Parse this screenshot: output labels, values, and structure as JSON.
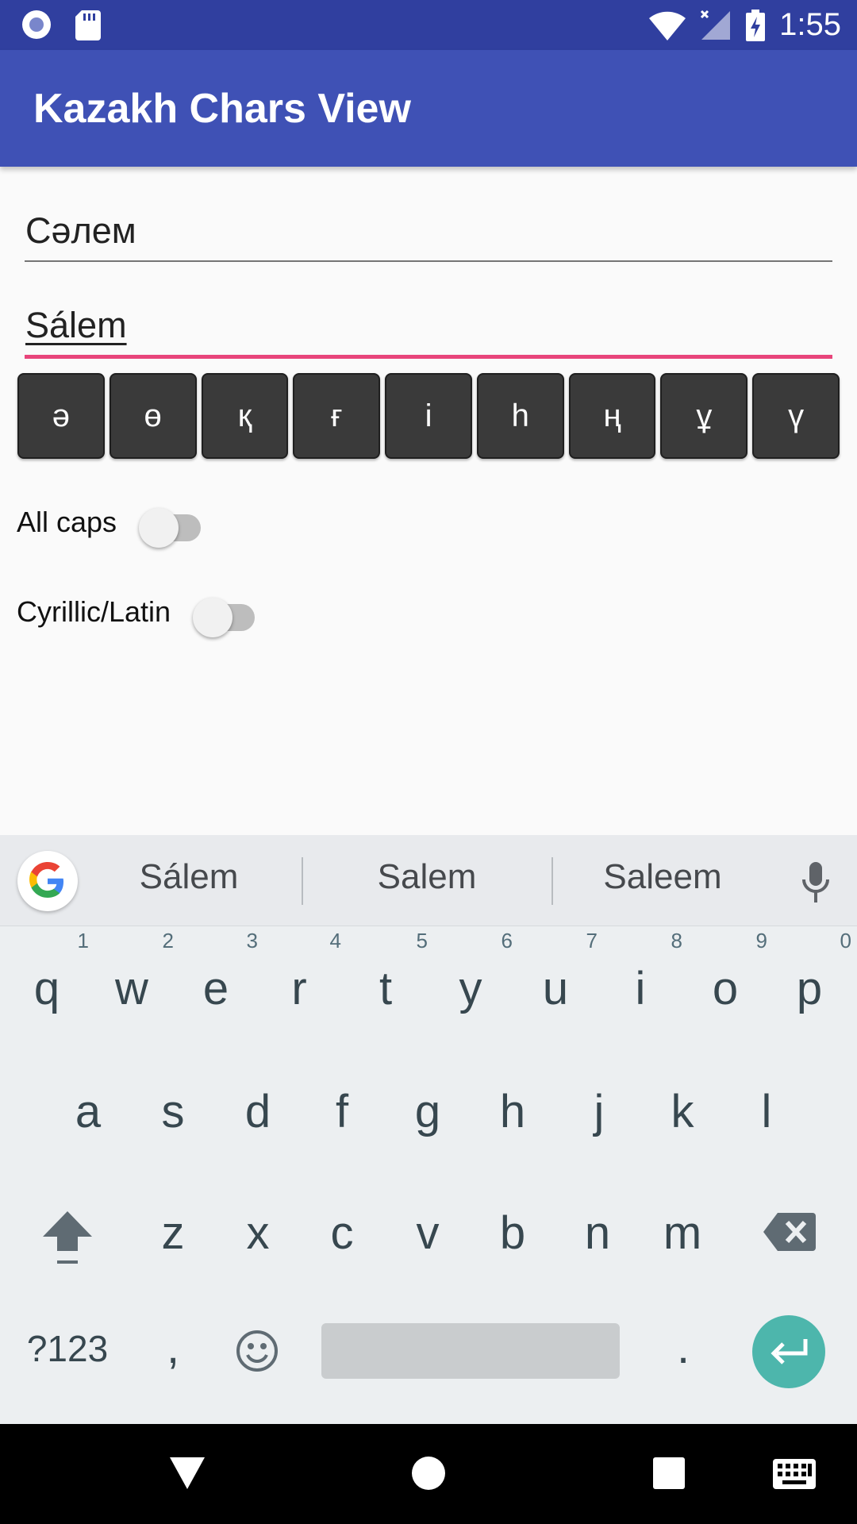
{
  "status_bar": {
    "time": "1:55"
  },
  "app_bar": {
    "title": "Kazakh Chars View"
  },
  "fields": {
    "cyrillic_value": "Сәлем",
    "latin_value": "Sálem"
  },
  "char_buttons": [
    "ә",
    "ө",
    "қ",
    "ғ",
    "і",
    "һ",
    "ң",
    "ұ",
    "ү"
  ],
  "switches": {
    "all_caps": {
      "label": "All caps",
      "on": false
    },
    "cyrillic_latin": {
      "label": "Cyrillic/Latin",
      "on": false
    }
  },
  "keyboard": {
    "suggestions": [
      "Sálem",
      "Salem",
      "Saleem"
    ],
    "row1": [
      "q",
      "w",
      "e",
      "r",
      "t",
      "y",
      "u",
      "i",
      "o",
      "p"
    ],
    "row1_hints": [
      "1",
      "2",
      "3",
      "4",
      "5",
      "6",
      "7",
      "8",
      "9",
      "0"
    ],
    "row2": [
      "a",
      "s",
      "d",
      "f",
      "g",
      "h",
      "j",
      "k",
      "l"
    ],
    "row3": [
      "z",
      "x",
      "c",
      "v",
      "b",
      "n",
      "m"
    ],
    "symbols_label": "?123",
    "comma": ",",
    "period": "."
  }
}
